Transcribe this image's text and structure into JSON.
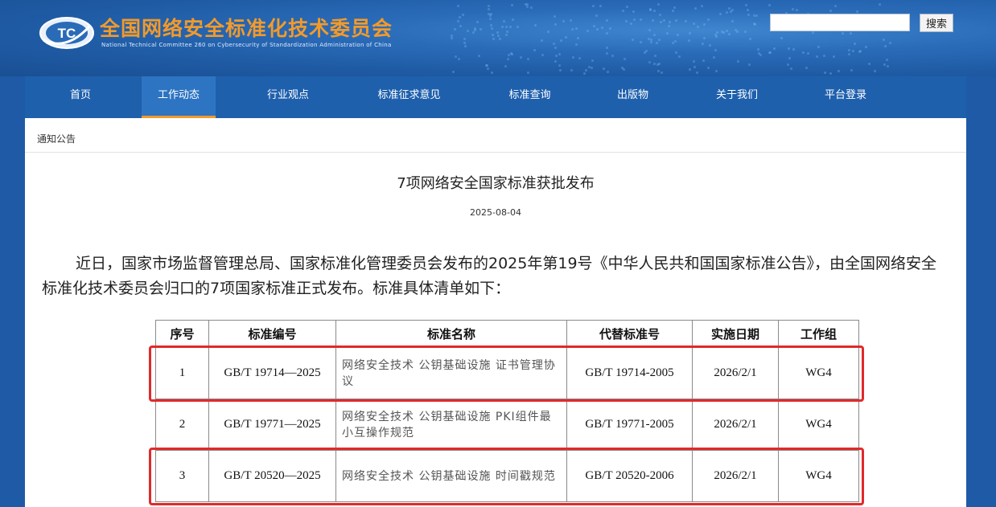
{
  "header": {
    "site_title": "全国网络安全标准化技术委员会",
    "site_subtitle": "National Technical Committee 260 on Cybersecurity of Standardization Administration of China",
    "logo_letters": "TC",
    "search_placeholder": "",
    "search_button": "搜索"
  },
  "nav": {
    "items": [
      {
        "label": "首页"
      },
      {
        "label": "工作动态"
      },
      {
        "label": "行业观点"
      },
      {
        "label": "标准征求意见"
      },
      {
        "label": "标准查询"
      },
      {
        "label": "出版物"
      },
      {
        "label": "关于我们"
      },
      {
        "label": "平台登录"
      }
    ],
    "active": "工作动态"
  },
  "breadcrumb": "通知公告",
  "article": {
    "title": "7项网络安全国家标准获批发布",
    "date": "2025-08-04",
    "body": "近日，国家市场监督管理总局、国家标准化管理委员会发布的2025年第19号《中华人民共和国国家标准公告》，由全国网络安全标准化技术委员会归口的7项国家标准正式发布。标准具体清单如下："
  },
  "table": {
    "headers": [
      "序号",
      "标准编号",
      "标准名称",
      "代替标准号",
      "实施日期",
      "工作组"
    ],
    "rows": [
      [
        "1",
        "GB/T 19714—2025",
        "网络安全技术 公钥基础设施 证书管理协议",
        "GB/T 19714-2005",
        "2026/2/1",
        "WG4"
      ],
      [
        "2",
        "GB/T 19771—2025",
        "网络安全技术 公钥基础设施 PKI组件最小互操作规范",
        "GB/T 19771-2005",
        "2026/2/1",
        "WG4"
      ],
      [
        "3",
        "GB/T 20520—2025",
        "网络安全技术 公钥基础设施 时间戳规范",
        "GB/T 20520-2006",
        "2026/2/1",
        "WG4"
      ]
    ]
  },
  "colors": {
    "nav_bg": "#1f60ad",
    "accent": "#f29a2a",
    "highlight": "#e02a2a"
  }
}
